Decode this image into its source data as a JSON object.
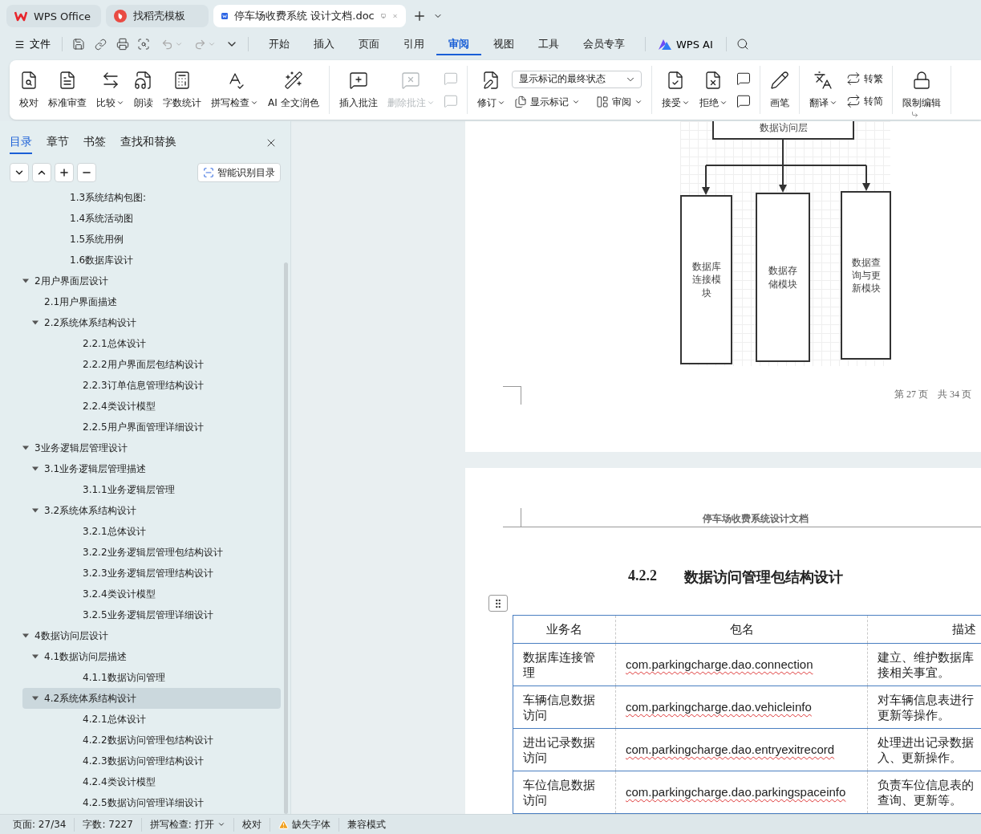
{
  "tabs": [
    {
      "label": "WPS Office",
      "kind": "home",
      "selected": false
    },
    {
      "label": "找稻壳模板",
      "kind": "template",
      "selected": false
    },
    {
      "label": "停车场收费系统 设计文档.doc",
      "kind": "document",
      "selected": true
    }
  ],
  "menu": {
    "file": "文件",
    "tabs": [
      {
        "label": "开始",
        "selected": false
      },
      {
        "label": "插入",
        "selected": false
      },
      {
        "label": "页面",
        "selected": false
      },
      {
        "label": "引用",
        "selected": false
      },
      {
        "label": "审阅",
        "selected": true
      },
      {
        "label": "视图",
        "selected": false
      },
      {
        "label": "工具",
        "selected": false
      },
      {
        "label": "会员专享",
        "selected": false
      }
    ],
    "ai": "WPS AI"
  },
  "ribbon": {
    "groups": [
      {
        "items": [
          {
            "kind": "large",
            "label": "校对",
            "dropdown": false,
            "disabled": false
          },
          {
            "kind": "large",
            "label": "标准审查",
            "dropdown": false,
            "disabled": false
          },
          {
            "kind": "large",
            "label": "比较",
            "dropdown": true,
            "disabled": false
          },
          {
            "kind": "large",
            "label": "朗读",
            "dropdown": false,
            "disabled": false
          },
          {
            "kind": "large",
            "label": "字数统计",
            "dropdown": false,
            "disabled": false
          },
          {
            "kind": "large",
            "label": "拼写检查",
            "dropdown": true,
            "disabled": false
          },
          {
            "kind": "large",
            "label": "AI 全文润色",
            "dropdown": false,
            "disabled": false
          }
        ]
      },
      {
        "items": [
          {
            "kind": "large",
            "label": "插入批注",
            "dropdown": false,
            "disabled": false
          },
          {
            "kind": "large",
            "label": "删除批注",
            "dropdown": true,
            "disabled": true
          },
          {
            "kind": "stack",
            "items": [
              {
                "disabled": true
              },
              {
                "disabled": true
              }
            ]
          }
        ]
      },
      {
        "items": [
          {
            "kind": "large",
            "label": "修订",
            "dropdown": true,
            "disabled": false
          },
          {
            "kind": "combo",
            "select": "显示标记的最终状态",
            "items": [
              {
                "label": "显示标记",
                "dropdown": true
              },
              {
                "label": "审阅",
                "dropdown": true
              }
            ]
          }
        ]
      },
      {
        "items": [
          {
            "kind": "large",
            "label": "接受",
            "dropdown": true,
            "disabled": false
          },
          {
            "kind": "large",
            "label": "拒绝",
            "dropdown": true,
            "disabled": false
          },
          {
            "kind": "stack",
            "items": [
              {
                "disabled": false
              },
              {
                "disabled": false
              }
            ]
          }
        ]
      },
      {
        "items": [
          {
            "kind": "large",
            "label": "画笔",
            "dropdown": false,
            "disabled": false
          }
        ]
      },
      {
        "items": [
          {
            "kind": "large",
            "label": "翻译",
            "dropdown": true,
            "disabled": false
          },
          {
            "kind": "stack",
            "items": [
              {
                "label": "转繁",
                "disabled": false
              },
              {
                "label": "转简",
                "disabled": false
              }
            ]
          }
        ]
      },
      {
        "items": [
          {
            "kind": "large",
            "label": "限制编辑",
            "dropdown": false,
            "disabled": false
          }
        ]
      }
    ]
  },
  "sidebar": {
    "tabs": [
      {
        "label": "目录",
        "selected": true
      },
      {
        "label": "章节",
        "selected": false
      },
      {
        "label": "书签",
        "selected": false
      },
      {
        "label": "查找和替换",
        "selected": false
      }
    ],
    "smart_button": "智能识别目录"
  },
  "outline": {
    "continued": [
      "1.3系统结构包图:",
      "1.4系统活动图",
      "1.5系统用例",
      "1.6数据库设计"
    ],
    "items": [
      {
        "label": "2用户界面层设计",
        "expanded": true,
        "selected": false,
        "children": [
          {
            "label": "2.1用户界面描述",
            "selected": false
          },
          {
            "label": "2.2系统体系结构设计",
            "expanded": true,
            "selected": false,
            "children": [
              {
                "label": "2.2.1总体设计",
                "selected": false
              },
              {
                "label": "2.2.2用户界面层包结构设计",
                "selected": false
              },
              {
                "label": "2.2.3订单信息管理结构设计",
                "selected": false
              },
              {
                "label": "2.2.4类设计模型",
                "selected": false
              },
              {
                "label": "2.2.5用户界面管理详细设计",
                "selected": false
              }
            ]
          }
        ]
      },
      {
        "label": "3业务逻辑层管理设计",
        "expanded": true,
        "selected": false,
        "children": [
          {
            "label": "3.1业务逻辑层管理描述",
            "expanded": true,
            "selected": false,
            "children": [
              {
                "label": "3.1.1业务逻辑层管理",
                "selected": false
              }
            ]
          },
          {
            "label": "3.2系统体系结构设计",
            "expanded": true,
            "selected": false,
            "children": [
              {
                "label": "3.2.1总体设计",
                "selected": false
              },
              {
                "label": "3.2.2业务逻辑层管理包结构设计",
                "selected": false
              },
              {
                "label": "3.2.3业务逻辑层管理结构设计",
                "selected": false
              },
              {
                "label": "3.2.4类设计模型",
                "selected": false
              },
              {
                "label": "3.2.5业务逻辑层管理详细设计",
                "selected": false
              }
            ]
          }
        ]
      },
      {
        "label": "4数据访问层设计",
        "expanded": true,
        "selected": false,
        "children": [
          {
            "label": "4.1数据访问层描述",
            "expanded": true,
            "selected": false,
            "children": [
              {
                "label": "4.1.1数据访问管理",
                "selected": false
              }
            ]
          },
          {
            "label": "4.2系统体系结构设计",
            "expanded": true,
            "selected": true,
            "children": [
              {
                "label": "4.2.1总体设计",
                "selected": false
              },
              {
                "label": "4.2.2数据访问管理包结构设计",
                "selected": false
              },
              {
                "label": "4.2.3数据访问管理结构设计",
                "selected": false
              },
              {
                "label": "4.2.4类设计模型",
                "selected": false
              },
              {
                "label": "4.2.5数据访问管理详细设计",
                "selected": false
              }
            ]
          }
        ]
      }
    ]
  },
  "page1": {
    "diagram": {
      "top": "数据访问层",
      "modules": [
        "数据库连接模块",
        "数据存储模块",
        "数据查询与更新模块"
      ]
    },
    "footer": [
      "第 27 页",
      "共 34 页"
    ]
  },
  "page2": {
    "header": "停车场收费系统设计文档",
    "heading": {
      "number": "4.2.2",
      "title": "数据访问管理包结构设计"
    },
    "table": {
      "columns": [
        "业务名",
        "包名",
        "描述"
      ],
      "rows": [
        {
          "name": "数据库连接管理",
          "package": "com.parkingcharge.dao.connection",
          "description": [
            "建立、维护数据库",
            "接相关事宜。"
          ]
        },
        {
          "name": "车辆信息数据访问",
          "package": "com.parkingcharge.dao.vehicleinfo",
          "description": [
            "对车辆信息表进行",
            "更新等操作。"
          ]
        },
        {
          "name": "进出记录数据访问",
          "package": "com.parkingcharge.dao.entryexitrecord",
          "description": [
            "处理进出记录数据",
            "入、更新操作。"
          ]
        },
        {
          "name": "车位信息数据访问",
          "package": "com.parkingcharge.dao.parkingspaceinfo",
          "description": [
            "负责车位信息表的",
            "查询、更新等。"
          ]
        }
      ]
    }
  },
  "status_bar": [
    {
      "kind": "text",
      "label": "页面: 27/34"
    },
    {
      "kind": "text",
      "label": "字数: 7227"
    },
    {
      "kind": "dropdown",
      "label": "拼写检查: 打开"
    },
    {
      "kind": "text",
      "label": "校对"
    },
    {
      "kind": "warning",
      "label": "缺失字体"
    },
    {
      "kind": "text",
      "label": "兼容模式"
    }
  ]
}
